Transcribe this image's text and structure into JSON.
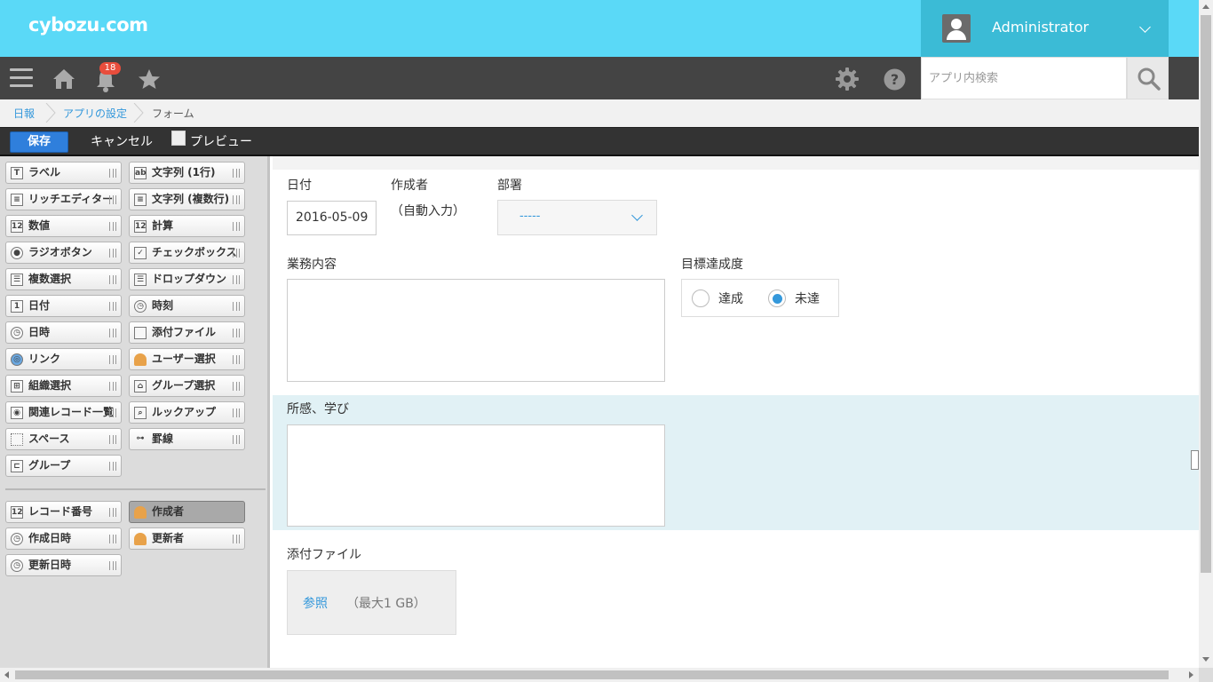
{
  "header": {
    "logo": "cybozu.com",
    "username": "Administrator",
    "search_placeholder": "アプリ内検索",
    "notification_count": "18",
    "colors": {
      "header_bg": "#5ad9f7",
      "user_bg": "#3bbbd6",
      "nav_bg": "#444444",
      "badge": "#e84d3c"
    }
  },
  "breadcrumb": [
    "日報",
    "アプリの設定",
    "フォーム"
  ],
  "toolbar": {
    "save": "保存",
    "cancel": "キャンセル",
    "preview": "プレビュー"
  },
  "palette": {
    "fields": [
      {
        "label": "ラベル",
        "icon": "text-T-icon"
      },
      {
        "label": "文字列 (1行)",
        "icon": "single-line-text-icon"
      },
      {
        "label": "リッチエディター",
        "icon": "rich-editor-icon"
      },
      {
        "label": "文字列 (複数行)",
        "icon": "multi-line-text-icon"
      },
      {
        "label": "数値",
        "icon": "number-icon"
      },
      {
        "label": "計算",
        "icon": "calc-icon"
      },
      {
        "label": "ラジオボタン",
        "icon": "radio-icon"
      },
      {
        "label": "チェックボックス",
        "icon": "checkbox-icon"
      },
      {
        "label": "複数選択",
        "icon": "multi-select-icon"
      },
      {
        "label": "ドロップダウン",
        "icon": "dropdown-icon"
      },
      {
        "label": "日付",
        "icon": "calendar-icon"
      },
      {
        "label": "時刻",
        "icon": "clock-icon"
      },
      {
        "label": "日時",
        "icon": "datetime-icon"
      },
      {
        "label": "添付ファイル",
        "icon": "file-icon"
      },
      {
        "label": "リンク",
        "icon": "globe-icon"
      },
      {
        "label": "ユーザー選択",
        "icon": "user-icon"
      },
      {
        "label": "組織選択",
        "icon": "org-icon"
      },
      {
        "label": "グループ選択",
        "icon": "group-icon"
      },
      {
        "label": "関連レコード一覧",
        "icon": "related-records-icon"
      },
      {
        "label": "ルックアップ",
        "icon": "lookup-icon"
      },
      {
        "label": "スペース",
        "icon": "space-icon"
      },
      {
        "label": "罫線",
        "icon": "border-line-icon"
      },
      {
        "label": "グループ",
        "icon": "group-folder-icon"
      }
    ],
    "system_fields": [
      {
        "label": "レコード番号",
        "icon": "number-icon"
      },
      {
        "label": "作成者",
        "icon": "user-icon"
      },
      {
        "label": "作成日時",
        "icon": "clock-icon"
      },
      {
        "label": "更新者",
        "icon": "user-icon"
      },
      {
        "label": "更新日時",
        "icon": "clock-icon"
      }
    ]
  },
  "form": {
    "date_label": "日付",
    "date_value": "2016-05-09",
    "creator_label": "作成者",
    "creator_value": "（自動入力）",
    "dept_label": "部署",
    "dept_value": "-----",
    "task_label": "業務内容",
    "goal_label": "目標達成度",
    "goal_options": [
      "達成",
      "未達"
    ],
    "goal_selected": "未達",
    "reflection_label": "所感、学び",
    "attach_label": "添付ファイル",
    "attach_browse": "参照",
    "attach_limit": "（最大1 GB）"
  }
}
